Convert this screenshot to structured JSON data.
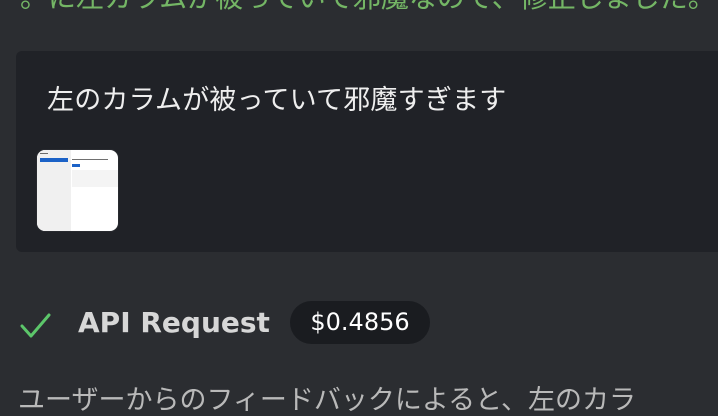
{
  "top_fragment": "。に左カラムが被っていて邪魔なので、修正しました。",
  "message": {
    "text": "左のカラムが被っていて邪魔すぎます"
  },
  "api_request": {
    "status_icon": "check-icon",
    "title": "API Request",
    "cost": "$0.4856"
  },
  "bottom_fragment": "ユーザーからのフィードバックによると、左のカラ",
  "colors": {
    "background": "#2b2d31",
    "message_box": "#202227",
    "success": "#5cc66a",
    "badge": "#1a1c20"
  }
}
